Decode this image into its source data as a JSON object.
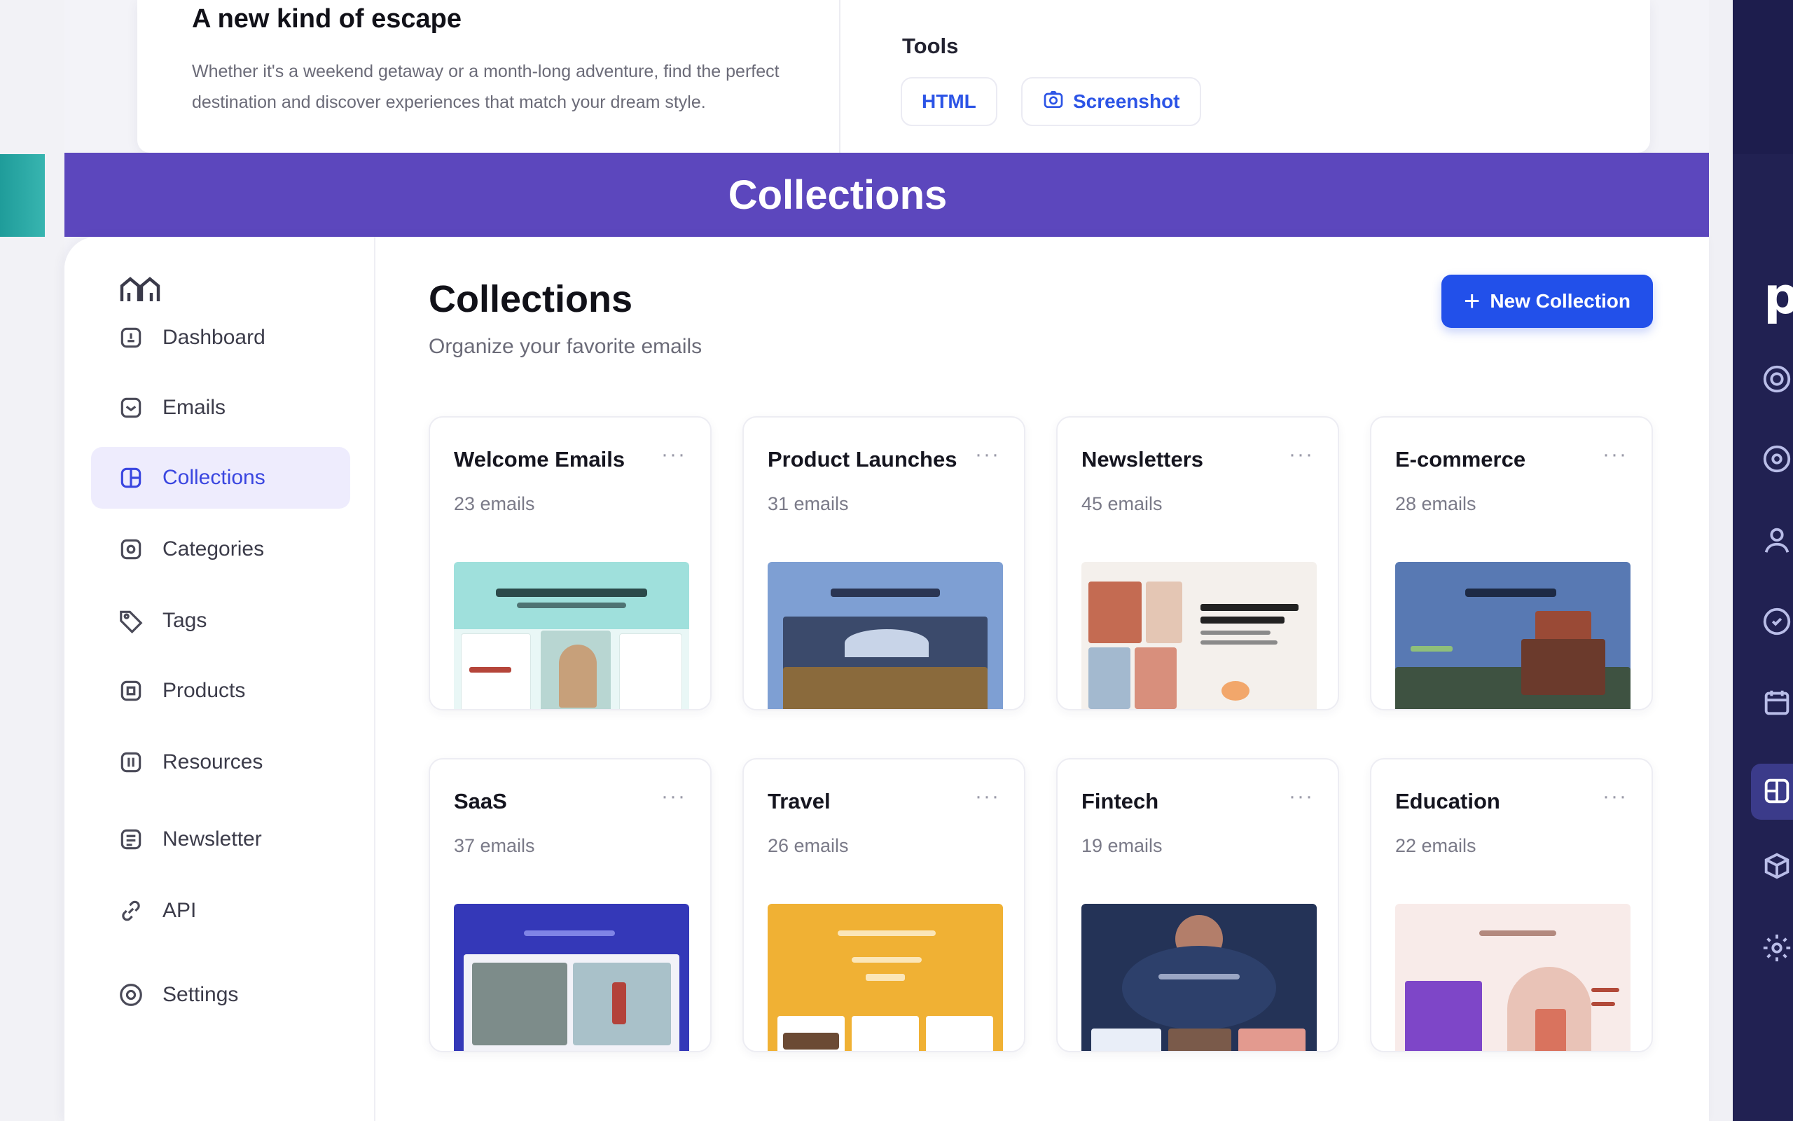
{
  "top_card": {
    "title": "A new kind of escape",
    "description": "Whether it's a weekend getaway or a month-long adventure, find the perfect destination and discover experiences that match your dream style.",
    "tools_label": "Tools",
    "tools": [
      {
        "label": "HTML",
        "icon": "code-icon"
      },
      {
        "label": "Screenshot",
        "icon": "camera-icon"
      }
    ]
  },
  "banner": {
    "title": "Collections"
  },
  "sidebar": {
    "logo": "app-logo",
    "items": [
      {
        "label": "Dashboard",
        "icon": "home-icon",
        "active": false
      },
      {
        "label": "Emails",
        "icon": "inbox-icon",
        "active": false
      },
      {
        "label": "Collections",
        "icon": "collections-icon",
        "active": true
      },
      {
        "label": "Categories",
        "icon": "categories-icon",
        "active": false
      },
      {
        "label": "Tags",
        "icon": "tag-icon",
        "active": false
      },
      {
        "label": "Products",
        "icon": "box-icon",
        "active": false
      },
      {
        "label": "Resources",
        "icon": "book-icon",
        "active": false
      },
      {
        "label": "Newsletter",
        "icon": "newsletter-icon",
        "active": false
      },
      {
        "label": "API",
        "icon": "link-icon",
        "active": false
      },
      {
        "label": "Settings",
        "icon": "gear-icon",
        "active": false
      }
    ]
  },
  "header": {
    "title": "Collections",
    "subtitle": "Organize your favorite emails",
    "new_button": "New Collection"
  },
  "collections": [
    {
      "name": "Welcome Emails",
      "count": "23 emails",
      "theme": "#9fe0dc"
    },
    {
      "name": "Product Launches",
      "count": "31 emails",
      "theme": "#6f8fc7"
    },
    {
      "name": "Newsletters",
      "count": "45 emails",
      "theme": "#f1ece8"
    },
    {
      "name": "E-commerce",
      "count": "28 emails",
      "theme": "#4f6fa8"
    },
    {
      "name": "SaaS",
      "count": "37 emails",
      "theme": "#3438b8"
    },
    {
      "name": "Travel",
      "count": "26 emails",
      "theme": "#f0b134"
    },
    {
      "name": "Fintech",
      "count": "19 emails",
      "theme": "#243357"
    },
    {
      "name": "Education",
      "count": "22 emails",
      "theme": "#f6e5e3"
    }
  ],
  "more_label": "···",
  "colors": {
    "banner": "#5c47bd",
    "accent": "#2250ea",
    "active_bg": "#eeecfd",
    "active_text": "#3a46e0",
    "right_rail": "#212152"
  }
}
